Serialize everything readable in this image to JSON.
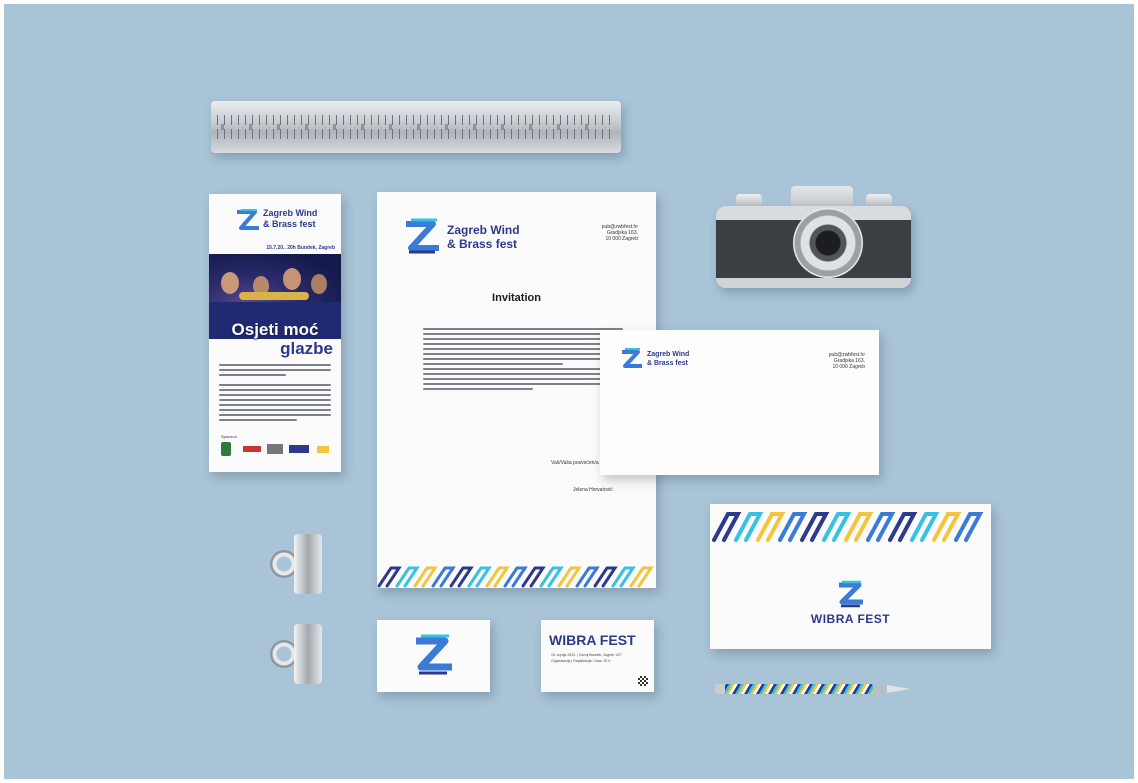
{
  "brand": {
    "name_line1": "Zagreb Wind",
    "name_line2": "& Brass fest",
    "short_name": "WIBRA FEST",
    "colors": {
      "navy": "#2d3a8c",
      "blue": "#3a7bd5",
      "cyan": "#36c2e0",
      "yellow": "#f2c53d",
      "background": "#a9c4d7"
    }
  },
  "flyer": {
    "date_line": "15.7.20.. 20h Bundek, Zagreb",
    "headline_1": "Osjeti moć",
    "headline_2": "glazbe",
    "sponsors_label": "Sponzori"
  },
  "letterhead": {
    "address_1": "pub@zwbfest.hr",
    "address_2": "Gradjska 163,",
    "address_3": "10 000 Zagreb",
    "heading": "Invitation",
    "closing": "Vaš/Vaša posvećen/a",
    "signature": "Jelena Horvatović"
  },
  "envelope_small": {
    "address_1": "pub@zwbfest.hr",
    "address_2": "Gradjska 163,",
    "address_3": "10 000 Zagreb"
  },
  "business_card": {
    "title": "WIBRA FEST",
    "line_1": "15. srpnja 2023. | Gornji Bundek, Zagreb 12/7",
    "line_2": "Organizacija | Registracija / Ulaz: 20 h"
  },
  "envelope_large": {
    "title": "WIBRA FEST"
  }
}
